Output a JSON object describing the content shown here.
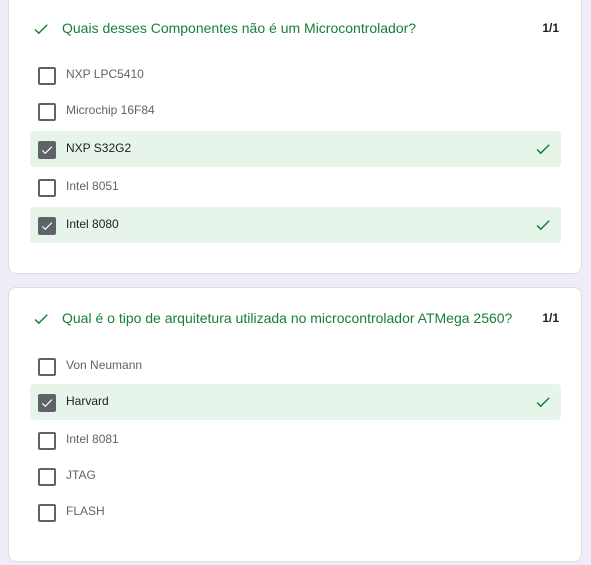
{
  "questions": [
    {
      "title": "Quais desses Componentes não é um Microcontrolador?",
      "score": "1/1",
      "status_icon": "check-icon",
      "options": [
        {
          "label": "NXP LPC5410",
          "checked": false,
          "correct": false
        },
        {
          "label": "Microchip 16F84",
          "checked": false,
          "correct": false
        },
        {
          "label": "NXP S32G2",
          "checked": true,
          "correct": true
        },
        {
          "label": "Intel 8051",
          "checked": false,
          "correct": false
        },
        {
          "label": "Intel 8080",
          "checked": true,
          "correct": true
        }
      ]
    },
    {
      "title": "Qual é o tipo de arquitetura utilizada no microcontrolador ATMega 2560?",
      "score": "1/1",
      "status_icon": "check-icon",
      "options": [
        {
          "label": "Von Neumann",
          "checked": false,
          "correct": false
        },
        {
          "label": "Harvard",
          "checked": true,
          "correct": true
        },
        {
          "label": "Intel 8081",
          "checked": false,
          "correct": false
        },
        {
          "label": "JTAG",
          "checked": false,
          "correct": false
        },
        {
          "label": "FLASH",
          "checked": false,
          "correct": false
        }
      ]
    }
  ],
  "colors": {
    "correct_green": "#188038",
    "correct_bg": "#e6f4ea",
    "checkbox_gray": "#5f6368",
    "page_bg": "#f0ebf8"
  }
}
